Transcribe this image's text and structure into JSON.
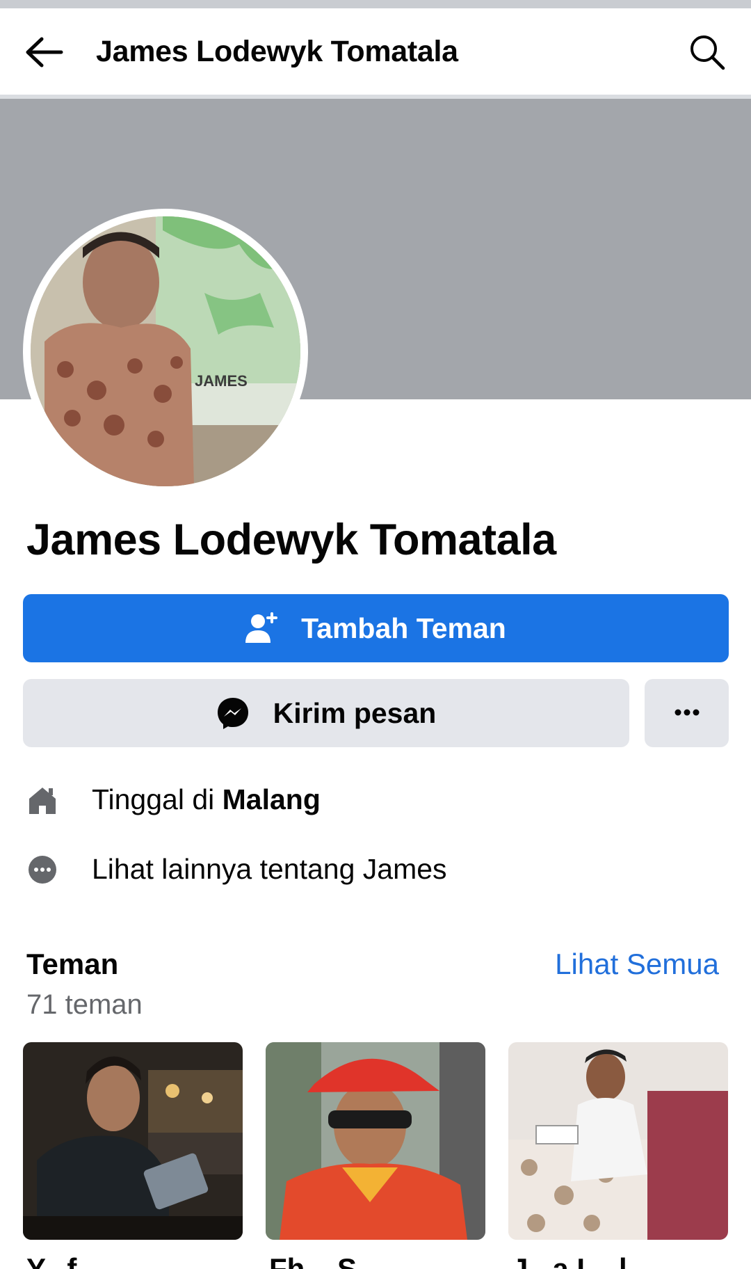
{
  "header": {
    "title": "James Lodewyk Tomatala",
    "back_icon": "arrow-left-icon",
    "search_icon": "search-icon"
  },
  "profile": {
    "name": "James Lodewyk Tomatala",
    "avatar_text": "JAMES"
  },
  "actions": {
    "add_friend_label": "Tambah Teman",
    "message_label": "Kirim pesan",
    "more_icon": "more-dots-icon"
  },
  "info": {
    "lives_in_prefix": "Tinggal di ",
    "lives_in_city": "Malang",
    "see_more_about": "Lihat lainnya tentang James"
  },
  "friends": {
    "heading": "Teman",
    "count": "71 teman",
    "see_all": "Lihat Semua",
    "items": [
      {
        "name": "Y...f..."
      },
      {
        "name": "Fh... S..."
      },
      {
        "name": "J...a L...l..."
      }
    ]
  },
  "colors": {
    "primary": "#1b74e4",
    "secondary_bg": "#e4e6eb",
    "link": "#216fdb",
    "cover": "#a3a6ab"
  }
}
